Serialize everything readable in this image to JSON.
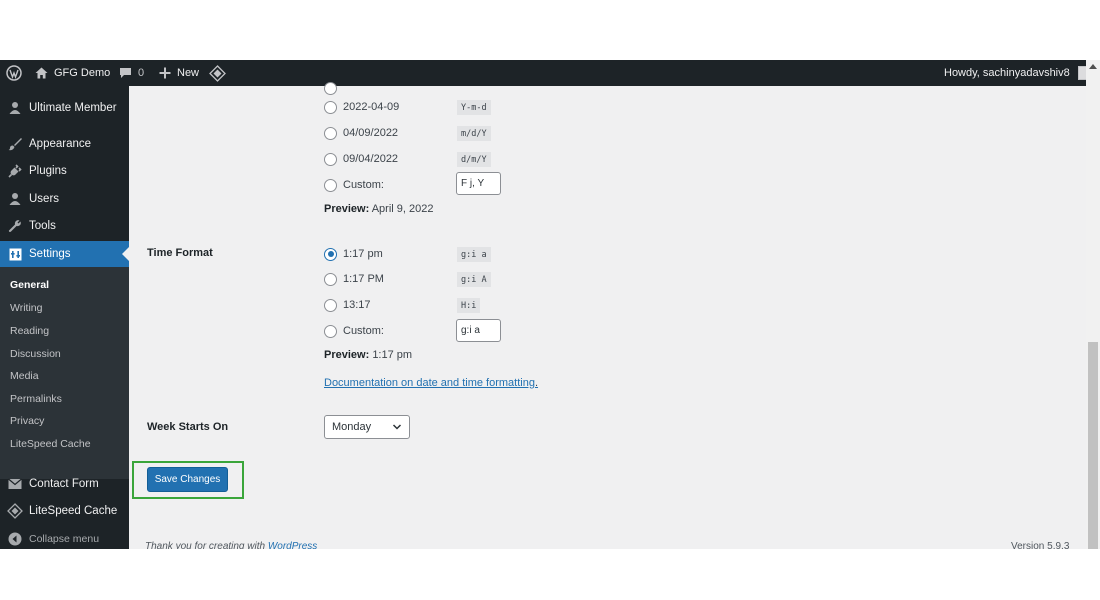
{
  "adminbar": {
    "site_name": "GFG Demo",
    "comments_count": "0",
    "new_label": "New",
    "howdy": "Howdy, sachinyadavshiv8"
  },
  "sidebar": {
    "items": [
      {
        "label": "Ultimate Member",
        "icon": "user-icon"
      },
      {
        "label": "Appearance",
        "icon": "brush-icon"
      },
      {
        "label": "Plugins",
        "icon": "plug-icon"
      },
      {
        "label": "Users",
        "icon": "users-icon"
      },
      {
        "label": "Tools",
        "icon": "wrench-icon"
      },
      {
        "label": "Settings",
        "icon": "settings-icon"
      },
      {
        "label": "Contact Form",
        "icon": "mail-icon"
      },
      {
        "label": "LiteSpeed Cache",
        "icon": "diamond-icon"
      },
      {
        "label": "Collapse menu",
        "icon": "collapse-icon"
      }
    ],
    "submenu": [
      "General",
      "Writing",
      "Reading",
      "Discussion",
      "Media",
      "Permalinks",
      "Privacy",
      "LiteSpeed Cache"
    ]
  },
  "date_format": {
    "options": [
      {
        "label": "2022-04-09",
        "code": "Y-m-d"
      },
      {
        "label": "04/09/2022",
        "code": "m/d/Y"
      },
      {
        "label": "09/04/2022",
        "code": "d/m/Y"
      },
      {
        "label": "Custom:",
        "value": "F j, Y"
      }
    ],
    "preview_label": "Preview:",
    "preview_value": "April 9, 2022"
  },
  "time_format": {
    "label": "Time Format",
    "options": [
      {
        "label": "1:17 pm",
        "code": "g:i a",
        "checked": true
      },
      {
        "label": "1:17 PM",
        "code": "g:i A"
      },
      {
        "label": "13:17",
        "code": "H:i"
      },
      {
        "label": "Custom:",
        "value": "g:i a"
      }
    ],
    "preview_label": "Preview:",
    "preview_value": "1:17 pm",
    "doc_link": "Documentation on date and time formatting"
  },
  "week_starts": {
    "label": "Week Starts On",
    "selected": "Monday"
  },
  "save_button": "Save Changes",
  "footer": {
    "thanks_prefix": "Thank you for creating with",
    "thanks_link": "WordPress",
    "version": "Version 5.9.3"
  },
  "colors": {
    "adminbar_bg": "#1d2327",
    "accent": "#2271b1",
    "highlight": "#3aa53a",
    "content_bg": "#f0f0f1"
  }
}
